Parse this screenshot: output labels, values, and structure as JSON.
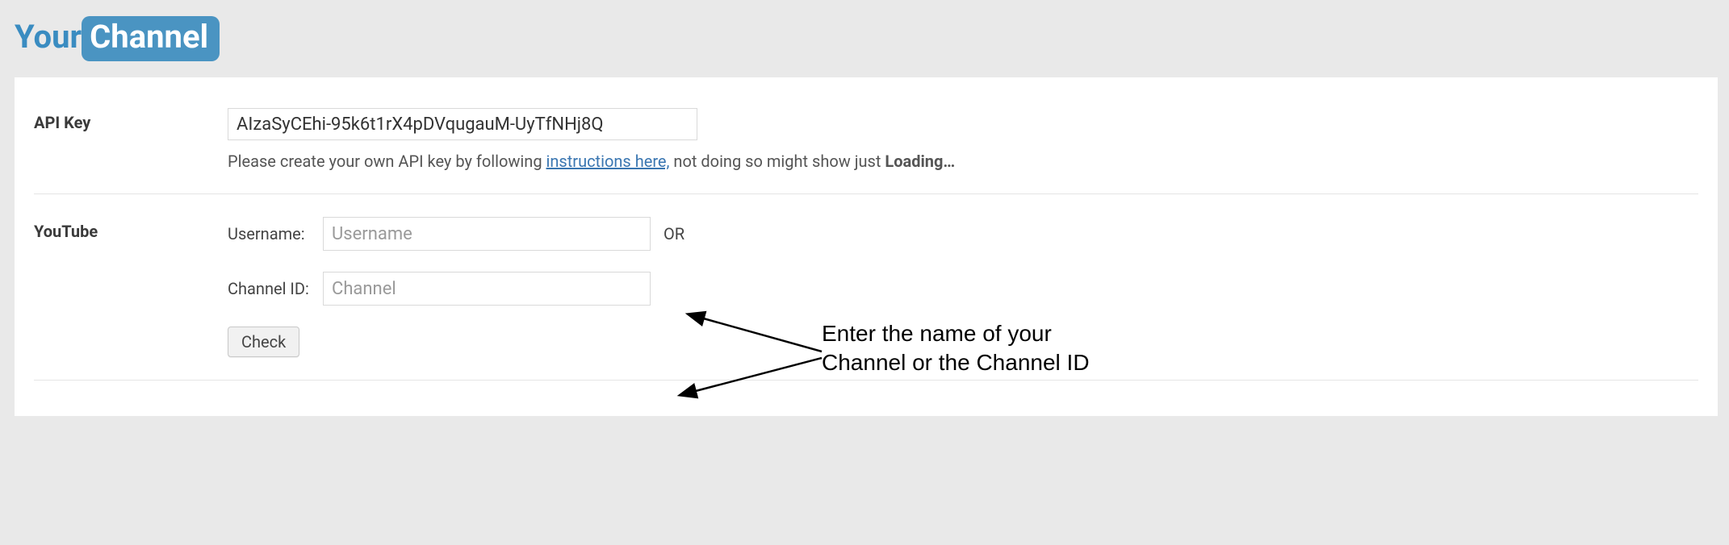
{
  "logo": {
    "part1": "Your",
    "part2": "Channel"
  },
  "apiKey": {
    "label": "API Key",
    "value": "AIzaSyCEhi-95k6t1rX4pDVqugauM-UyTfNHj8Q",
    "helpPrefix": "Please create your own API key by following ",
    "helpLink": "instructions here,",
    "helpMiddle": " not doing so might show just ",
    "helpBold": "Loading…"
  },
  "youtube": {
    "label": "YouTube",
    "usernameLabel": "Username:",
    "usernamePlaceholder": "Username",
    "or": "OR",
    "channelLabel": "Channel ID:",
    "channelPlaceholder": "Channel",
    "checkButton": "Check"
  },
  "annotation": {
    "line1": "Enter the name of your",
    "line2": "Channel or the Channel ID"
  }
}
